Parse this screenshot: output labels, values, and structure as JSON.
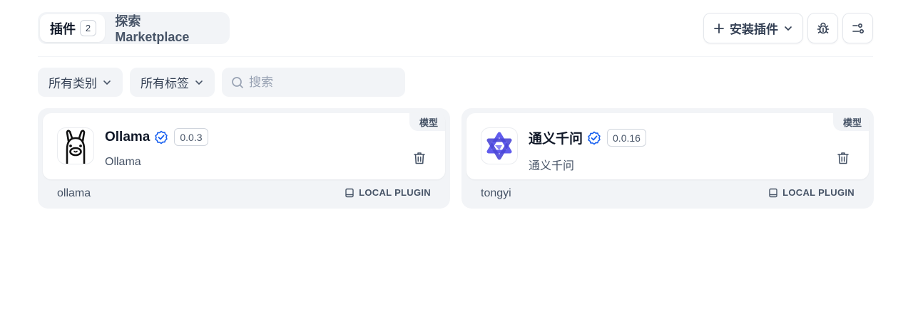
{
  "tabs": {
    "plugins_label": "插件",
    "plugins_count": "2",
    "marketplace_label": "探索 Marketplace"
  },
  "header": {
    "install_label": "安装插件"
  },
  "filters": {
    "category_label": "所有类别",
    "tags_label": "所有标签",
    "search_placeholder": "搜索"
  },
  "plugins": [
    {
      "name": "Ollama",
      "version": "0.0.3",
      "description": "Ollama",
      "category_tag": "模型",
      "slug": "ollama",
      "source": "LOCAL PLUGIN"
    },
    {
      "name": "通义千问",
      "version": "0.0.16",
      "description": "通义千问",
      "category_tag": "模型",
      "slug": "tongyi",
      "source": "LOCAL PLUGIN"
    }
  ],
  "colors": {
    "verified": "#155eef",
    "tongyi_brand": "#615ced"
  }
}
